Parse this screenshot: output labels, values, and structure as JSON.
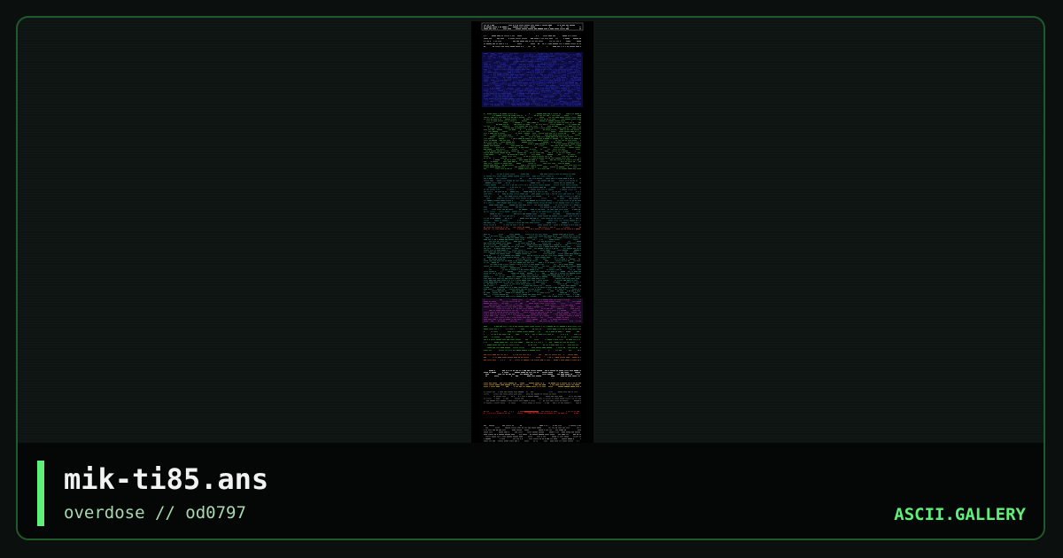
{
  "artwork": {
    "filename": "mik-ti85.ans",
    "pack_path": "overdose // od0797"
  },
  "site": {
    "brand": "ASCII.GALLERY"
  },
  "colors": {
    "accent": "#5ff07a",
    "frame_border": "#1f5a2c",
    "background": "#0b0f0e"
  }
}
